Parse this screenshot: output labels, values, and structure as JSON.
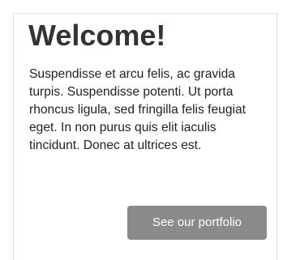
{
  "welcome": {
    "title": "Welcome!",
    "body": "Suspendisse et arcu felis, ac gravida turpis. Suspendisse potenti. Ut porta rhoncus ligula, sed fringilla felis feugiat eget. In non purus quis elit iaculis tincidunt. Donec at ultrices est.",
    "button_label": "See our portfolio"
  },
  "colors": {
    "button_background": "#8a8a8a",
    "title_text": "#333333",
    "body_text": "#222222"
  }
}
